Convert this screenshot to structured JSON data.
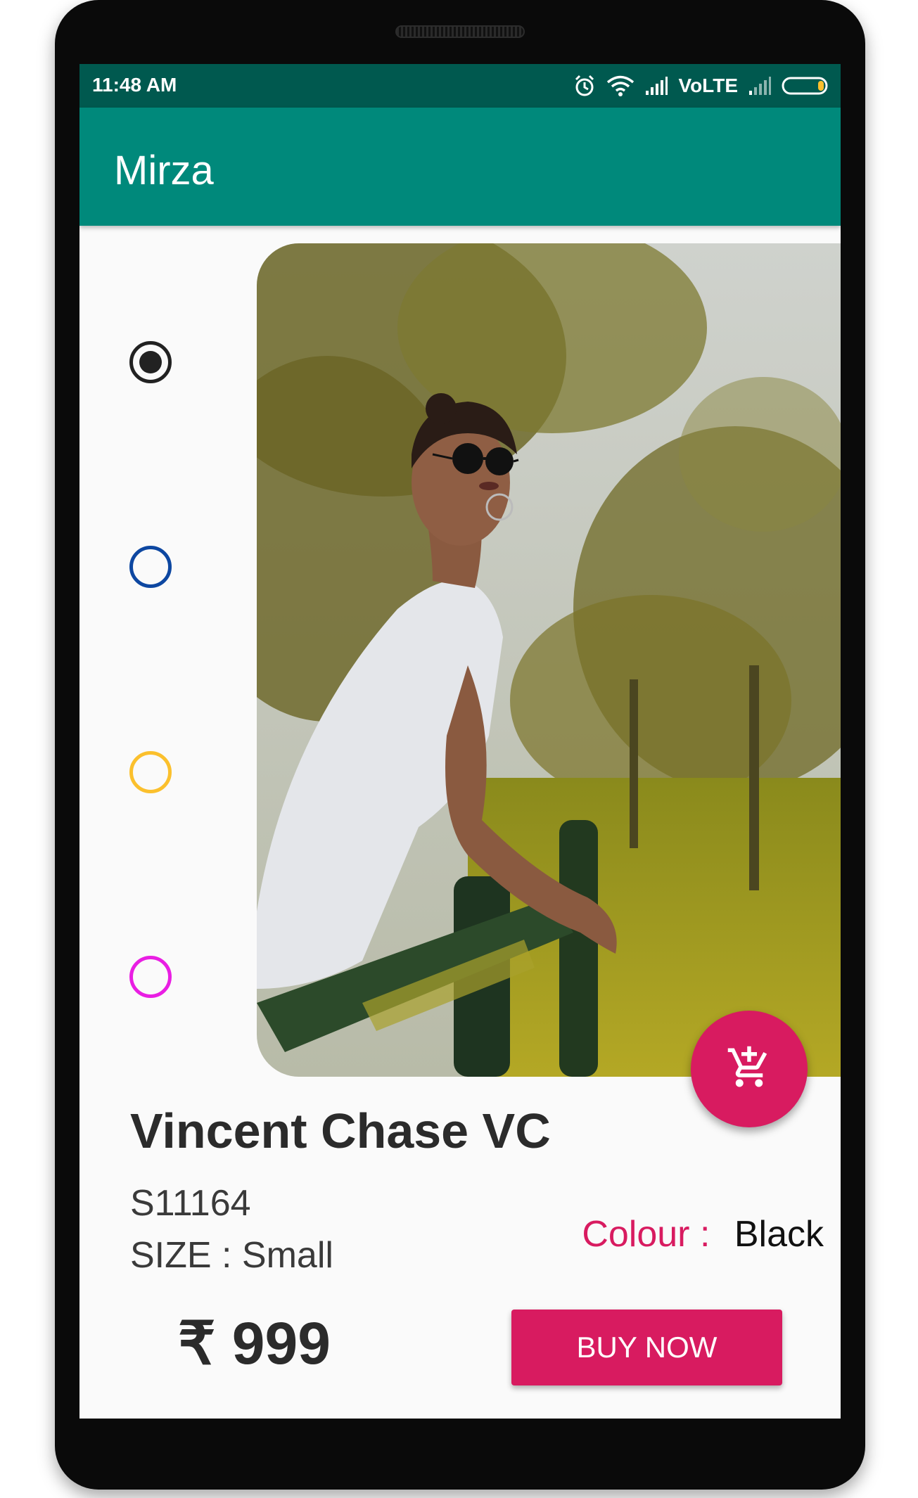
{
  "status_bar": {
    "time": "11:48 AM",
    "network_label": "VoLTE",
    "icons": [
      "alarm-icon",
      "wifi-icon",
      "signal-icon",
      "signal-icon",
      "battery-icon"
    ]
  },
  "app_bar": {
    "title": "Mirza"
  },
  "colour_options": [
    {
      "name": "black",
      "color": "#222222",
      "selected": true
    },
    {
      "name": "blue",
      "color": "#0d47a1",
      "selected": false
    },
    {
      "name": "yellow",
      "color": "#fbc02d",
      "selected": false
    },
    {
      "name": "magenta",
      "color": "#e91ee3",
      "selected": false
    }
  ],
  "product": {
    "name": "Vincent Chase VC",
    "sku": "S11164",
    "size_label": "SIZE : Small",
    "colour_label": "Colour :",
    "colour_value": "Black",
    "price": "₹ 999"
  },
  "actions": {
    "add_to_cart_icon": "add-shopping-cart-icon",
    "buy_now_label": "BUY NOW"
  },
  "theme": {
    "primary": "#00897b",
    "primary_dark": "#00594f",
    "accent": "#d81b60"
  }
}
